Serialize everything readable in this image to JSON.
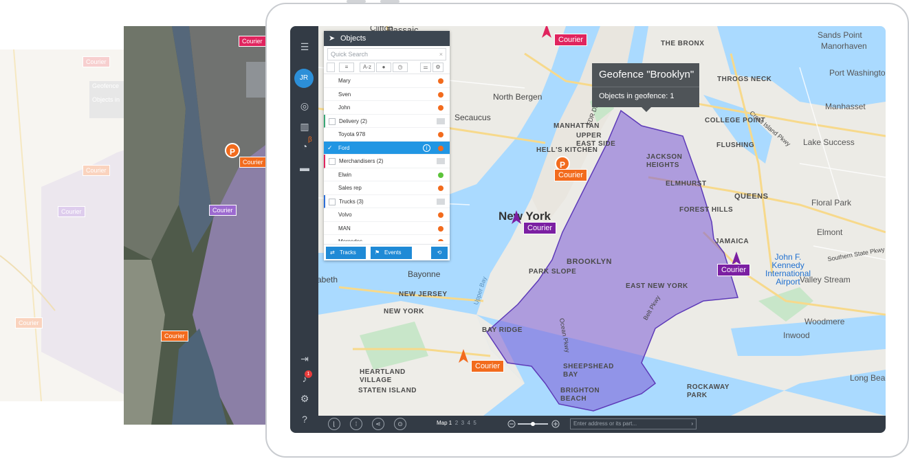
{
  "ghost_tags": {
    "courier": "Courier",
    "p": "P",
    "geofence": "Geofence",
    "objects_in": "Objects in"
  },
  "rail": {
    "avatar": "JR",
    "beta": "β",
    "notif_count": "1"
  },
  "panel": {
    "title": "Objects",
    "search_placeholder": "Quick Search",
    "sort_label": "A-z",
    "rows": [
      {
        "label": "Mary",
        "type": "item",
        "color": "#f26b1d"
      },
      {
        "label": "Sven",
        "type": "item",
        "color": "#f26b1d"
      },
      {
        "label": "John",
        "type": "item",
        "color": "#f26b1d"
      },
      {
        "label": "Delivery (2)",
        "type": "group",
        "color": "#3aa776"
      },
      {
        "label": "Toyota 978",
        "type": "item",
        "color": "#f26b1d"
      },
      {
        "label": "Ford",
        "type": "selected",
        "color": "#f26b1d"
      },
      {
        "label": "Merchandisers (2)",
        "type": "group",
        "color": "#e0245e"
      },
      {
        "label": "Elwin",
        "type": "item",
        "color": "#5cc33a"
      },
      {
        "label": "Sales rep",
        "type": "item",
        "color": "#f26b1d"
      },
      {
        "label": "Trucks (3)",
        "type": "group",
        "color": "#2c6fd8"
      },
      {
        "label": "Volvo",
        "type": "item",
        "color": "#f26b1d"
      },
      {
        "label": "MAN",
        "type": "item",
        "color": "#f26b1d"
      },
      {
        "label": "Mercedes",
        "type": "item",
        "color": "#f26b1d"
      }
    ],
    "tracks_label": "Tracks",
    "events_label": "Events"
  },
  "tooltip": {
    "title": "Geofence \"Brooklyn\"",
    "objects": "Objects in geofence: 1"
  },
  "map_labels": {
    "passaic": "Passaic",
    "clifton": "Clifton",
    "the_bronx": "THE BRONX",
    "sands_point": "Sands Point",
    "manorhaven": "Manorhaven",
    "port_washington": "Port Washington",
    "throgs_neck": "THROGS NECK",
    "north_bergen": "North Bergen",
    "manhattan": "MANHATTAN",
    "secaucus": "Secaucus",
    "manhasset": "Manhasset",
    "upper_east_side": "UPPER\nEAST SIDE",
    "hells_kitchen": "HELL'S KITCHEN",
    "college_point": "COLLEGE POINT",
    "flushing": "FLUSHING",
    "lake_success": "Lake Success",
    "jackson_heights": "JACKSON\nHEIGHTS",
    "elmhurst": "ELMHURST",
    "forest_hills": "FOREST HILLS",
    "queens": "QUEENS",
    "floral_park": "Floral Park",
    "new_york": "New York",
    "jamaica": "JAMAICA",
    "elmont": "Elmont",
    "brooklyn": "BROOKLYN",
    "park_slope": "PARK SLOPE",
    "east_new_york": "EAST NEW YORK",
    "bayonne": "Bayonne",
    "elizabeth": "abeth",
    "new_jersey": "NEW JERSEY",
    "jfk": "John F.\nKennedy\nInternational\nAirport",
    "valley_stream": "Valley Stream",
    "new_york_state": "NEW YORK",
    "bay_ridge": "BAY RIDGE",
    "woodmere": "Woodmere",
    "inwood": "Inwood",
    "heartland_village": "HEARTLAND\nVILLAGE",
    "staten_island": "STATEN ISLAND",
    "sheepshead_bay": "SHEEPSHEAD\nBAY",
    "brighton_beach": "BRIGHTON\nBEACH",
    "rockaway_park": "ROCKAWAY\nPARK",
    "long_beach": "Long Beac",
    "upper_bay": "Upper Bay",
    "fdr_dr": "FDR Dr",
    "ocean_pkwy": "Ocean Pkwy",
    "belt_pkwy": "Belt Pkwy",
    "cross_island": "Cross Island Pkwy",
    "southern_state": "Southern State Pkwy"
  },
  "courier_label": "Courier",
  "p_label": "P",
  "bottom": {
    "map1": "Map 1",
    "m2": "2",
    "m3": "3",
    "m4": "4",
    "m5": "5",
    "address_placeholder": "Enter address or its part..."
  }
}
